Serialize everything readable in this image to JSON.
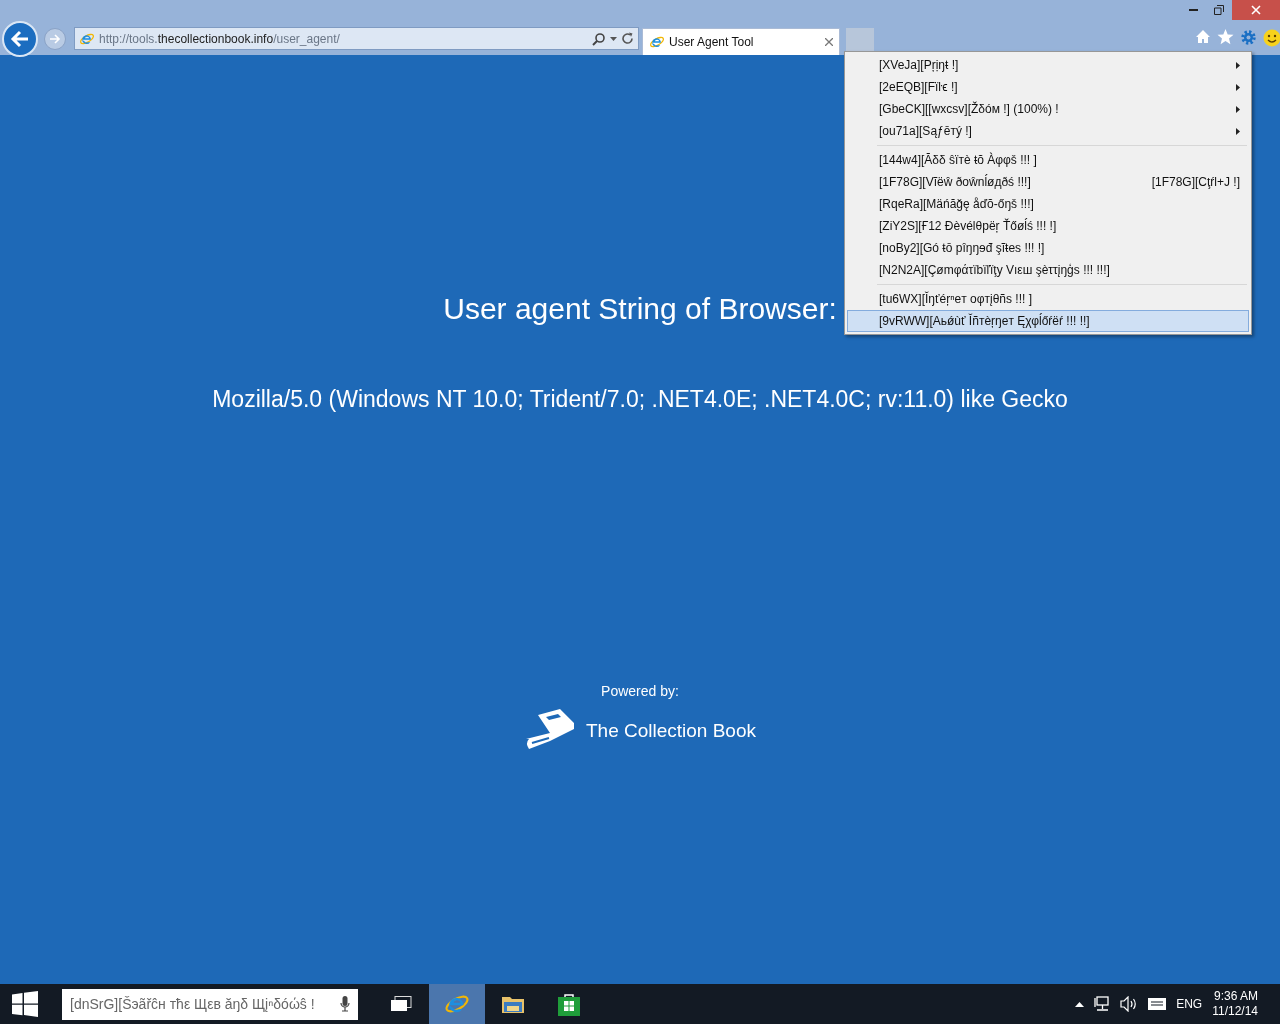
{
  "browser": {
    "address": {
      "scheme": "http://tools.",
      "domain": "thecollectionbook.info",
      "path": "/user_agent/"
    },
    "tabs": [
      {
        "title": "User Agent Tool",
        "selected": true
      }
    ]
  },
  "menu": {
    "groups": [
      [
        {
          "label": "[XVeJa][Pŗịŋŧ !]",
          "kind": "submenu",
          "selected": false
        },
        {
          "label": "[2eEQB][Fïŀϵ !]",
          "kind": "submenu",
          "selected": false
        },
        {
          "label": "[GbeCK][[wxcsv][Žδóм !] (100%) !",
          "kind": "submenu",
          "selected": false
        },
        {
          "label": "[ou71a][Sąƒēтý !]",
          "kind": "submenu",
          "selected": false
        }
      ],
      [
        {
          "label": "[144w4][Āδδ ŝïтè ŧŏ Àφφš !!! ]",
          "kind": "command",
          "selected": false
        },
        {
          "label": "[1F78G][Vĩëŵ ðoŵnĺøдðś !!!]",
          "kind": "command",
          "shortcut": "[1F78G][Cţŕl+J !]",
          "selected": false
        },
        {
          "label": "[RqeRa][Mäńăğę åďŏ-őŋš !!!]",
          "kind": "command",
          "selected": false
        },
        {
          "label": "[ZiY2S][Ғ12 Ðèvélθpëŗ Ťőøĺś !!! !]",
          "kind": "command",
          "selected": false
        },
        {
          "label": "[noBy2][Gó ŧō pîŋŋɘđ şĩŧes !!! !]",
          "kind": "command",
          "selected": false
        },
        {
          "label": "[N2N2A][Çømφάτïbïľïţy Vıεш şèττįŋģs !!! !!!]",
          "kind": "command",
          "selected": false
        }
      ],
      [
        {
          "label": "[tu6WX][Ĭŋťéŗⁿeт oφтįθñs !!! ]",
          "kind": "command",
          "selected": false
        },
        {
          "label": "[9vRWW][Aьǿùť Ĭñтèŗŋeт Ęχφĺőŕёŕ !!! !!]",
          "kind": "command",
          "selected": true
        }
      ]
    ]
  },
  "page": {
    "heading": "User agent String of Browser:",
    "user_agent": "Mozilla/5.0 (Windows NT 10.0; Trident/7.0; .NET4.0E; .NET4.0C; rv:11.0) like Gecko",
    "powered_by": "Powered by:",
    "brand": "The Collection Book"
  },
  "taskbar": {
    "search": {
      "placeholder": "[dnSrG][Šэãřĉн тħε Щεв ăŋδ Щįⁿδóώŝ !"
    },
    "apps": [
      {
        "kind": "taskview",
        "selected": false
      },
      {
        "kind": "browser",
        "selected": true
      },
      {
        "kind": "folder",
        "selected": false
      },
      {
        "kind": "store",
        "selected": false
      }
    ],
    "tray": {
      "language": "ENG",
      "time": "9:36 AM",
      "date": "11/12/14"
    }
  }
}
